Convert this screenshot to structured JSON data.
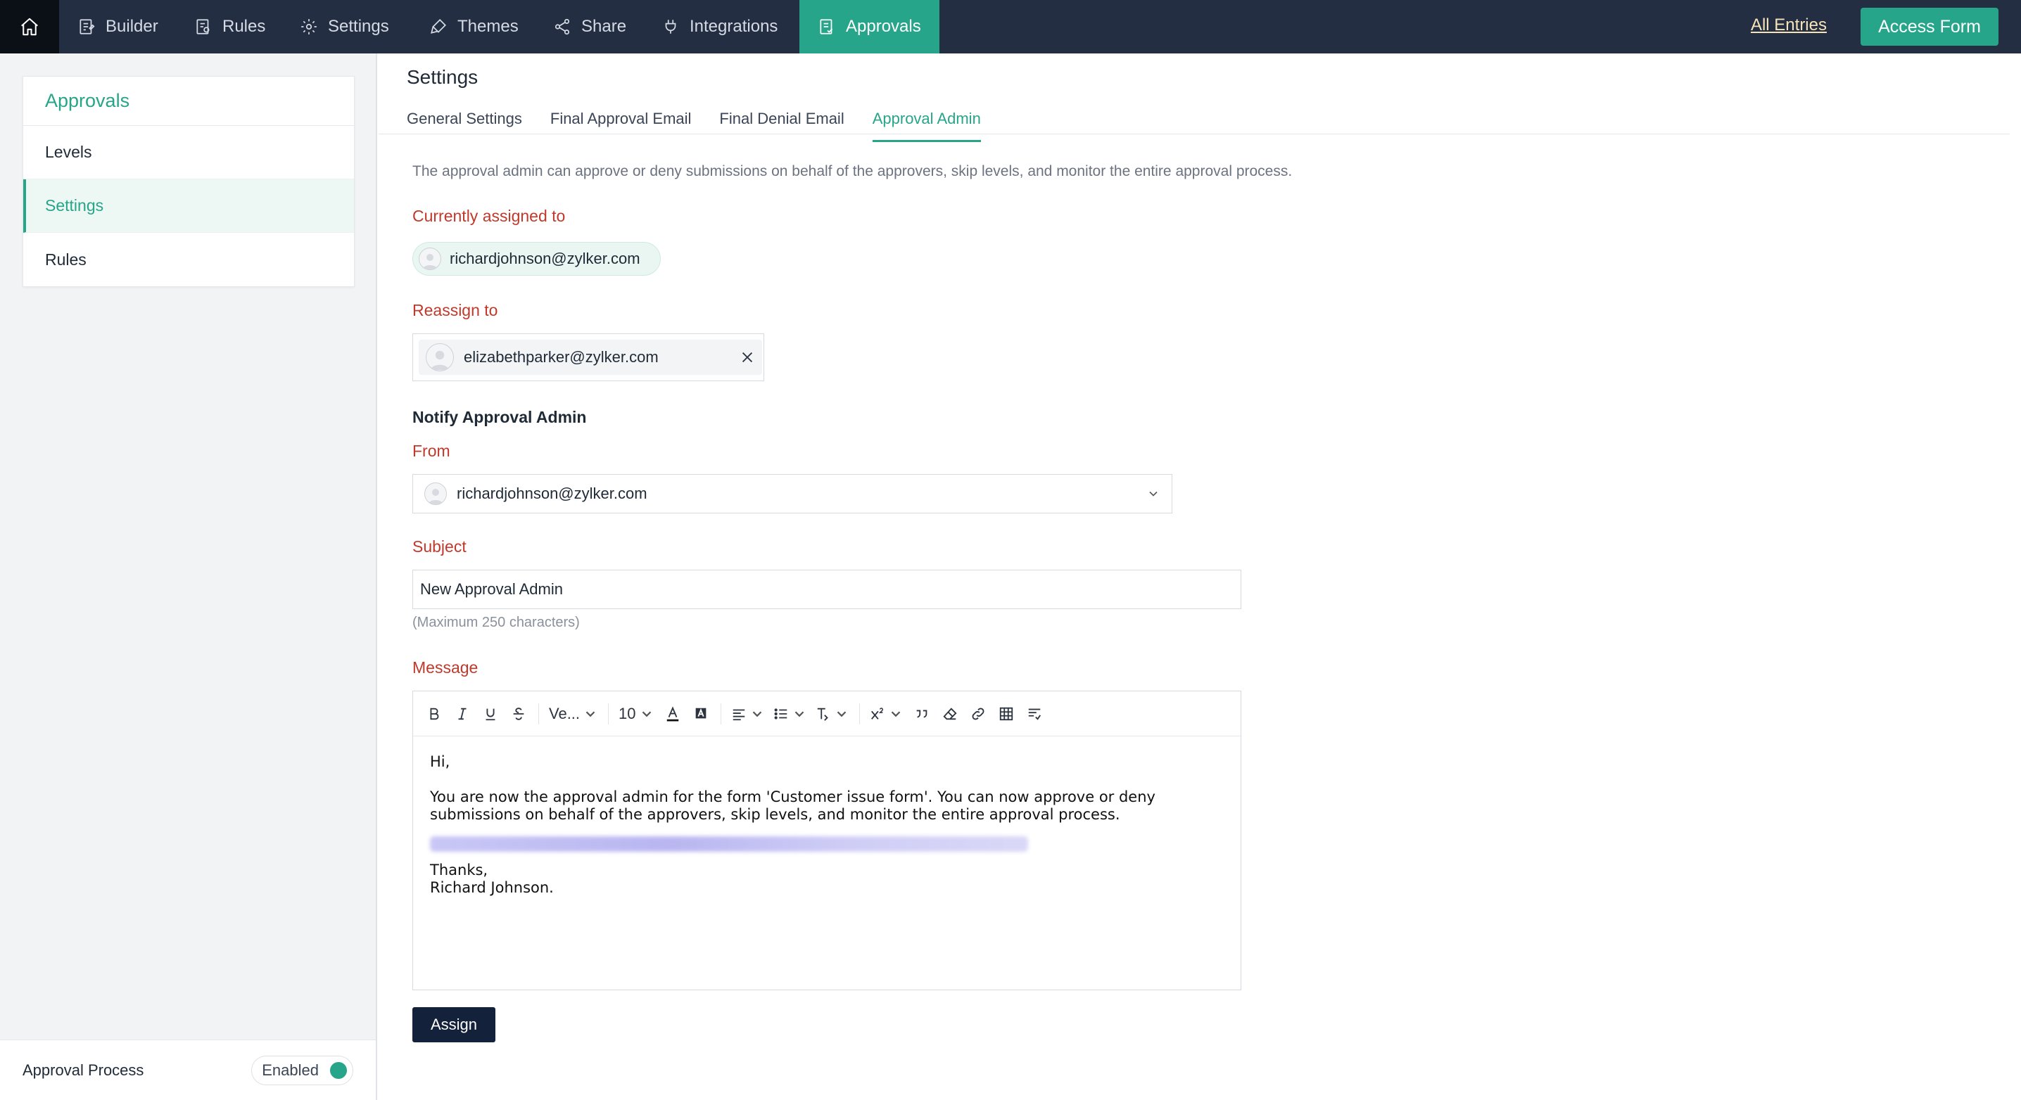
{
  "nav": {
    "items": [
      {
        "label": "Builder",
        "icon": "builder-icon"
      },
      {
        "label": "Rules",
        "icon": "rules-icon"
      },
      {
        "label": "Settings",
        "icon": "gear-icon"
      },
      {
        "label": "Themes",
        "icon": "brush-icon"
      },
      {
        "label": "Share",
        "icon": "share-icon"
      },
      {
        "label": "Integrations",
        "icon": "plug-icon"
      },
      {
        "label": "Approvals",
        "icon": "approvals-icon",
        "active": true
      }
    ],
    "all_entries": "All Entries",
    "access_form": "Access Form"
  },
  "sidebar": {
    "title": "Approvals",
    "items": [
      {
        "label": "Levels"
      },
      {
        "label": "Settings",
        "active": true
      },
      {
        "label": "Rules"
      }
    ],
    "approval_process": {
      "label": "Approval Process",
      "status": "Enabled"
    }
  },
  "page": {
    "title": "Settings",
    "tabs": [
      {
        "label": "General Settings"
      },
      {
        "label": "Final Approval Email"
      },
      {
        "label": "Final Denial Email"
      },
      {
        "label": "Approval Admin",
        "active": true
      }
    ]
  },
  "approval_admin": {
    "description": "The approval admin can approve or deny submissions on behalf of the approvers, skip levels, and monitor the entire approval process.",
    "currently_assigned_label": "Currently assigned to",
    "currently_assigned_email": "richardjohnson@zylker.com",
    "reassign_label": "Reassign to",
    "reassign_email": "elizabethparker@zylker.com",
    "notify_heading": "Notify Approval Admin",
    "from_label": "From",
    "from_email": "richardjohnson@zylker.com",
    "subject_label": "Subject",
    "subject_value": "New Approval Admin",
    "subject_hint": "(Maximum 250 characters)",
    "message_label": "Message",
    "toolbar": {
      "font_family": "Ve...",
      "font_size": "10"
    },
    "message": {
      "greeting": "Hi,",
      "body": "You are now the approval admin for the form 'Customer issue form'. You can now approve or deny\nsubmissions on behalf of the approvers, skip levels, and monitor the entire approval process.",
      "closing": "Thanks,\nRichard Johnson."
    },
    "assign_button": "Assign"
  },
  "colors": {
    "accent": "#27a58a",
    "nav_bg": "#232e42",
    "label_red": "#c0392b",
    "assign_bg": "#14213a"
  }
}
